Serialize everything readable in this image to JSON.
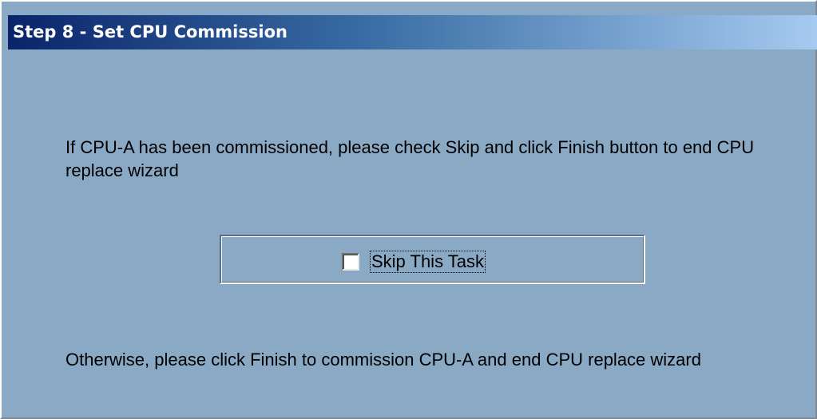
{
  "window": {
    "title": "Step 8 - Set CPU Commission"
  },
  "content": {
    "intro_text": "If CPU-A has been commissioned, please check Skip and click Finish button to end CPU replace wizard",
    "skip_checkbox": {
      "label": "Skip This Task",
      "checked": false
    },
    "otherwise_text": "Otherwise, please click Finish to commission CPU-A and end CPU replace wizard"
  },
  "colors": {
    "dialog_background": "#8aa9c4",
    "titlebar_start": "#0a246a",
    "titlebar_end": "#a6caf0",
    "title_text": "#ffffff"
  }
}
